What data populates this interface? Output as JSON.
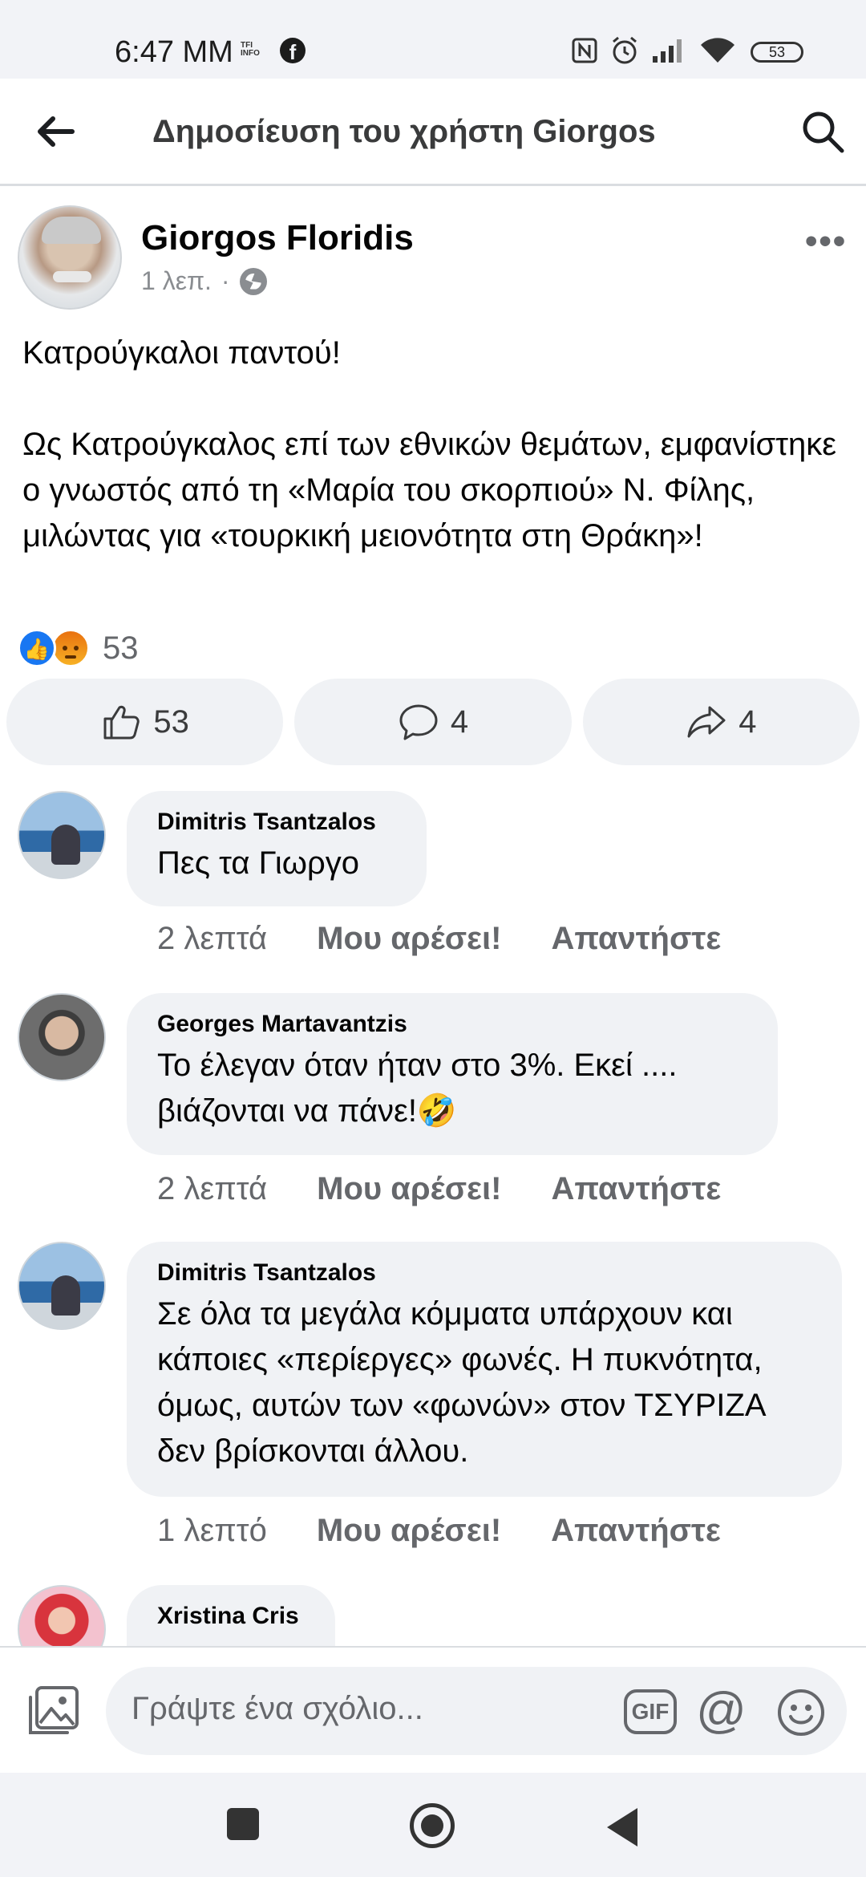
{
  "status_bar": {
    "time": "6:47 MM",
    "tfi_label": "TFI INFO",
    "battery": "53"
  },
  "header": {
    "title": "Δημοσίευση του χρήστη Giorgos"
  },
  "post": {
    "author": "Giorgos Floridis",
    "time": "1 λεπ.",
    "separator": "·",
    "more": "•••",
    "paragraphs": [
      "Κατρούγκαλοι παντού!",
      "Ως Κατρούγκαλος επί των εθνικών θεμάτων, εμφανίστηκε ο γνωστός από τη «Μαρία του σκορπιού» Ν. Φίλης, μιλώντας για «τουρκική μειονότητα στη Θράκη»!"
    ],
    "reaction_count": "53",
    "actions": {
      "like_count": "53",
      "comment_count": "4",
      "share_count": "4"
    }
  },
  "comments": [
    {
      "name": "Dimitris Tsantzalos",
      "text": "Πες τα Γιωργο",
      "time": "2 λεπτά",
      "like_label": "Μου αρέσει!",
      "reply_label": "Απαντήστε"
    },
    {
      "name": "Georges Martavantzis",
      "text": "Το έλεγαν όταν ήταν στο 3%. Εκεί .... βιάζονται να πάνε!🤣",
      "time": "2 λεπτά",
      "like_label": "Μου αρέσει!",
      "reply_label": "Απαντήστε"
    },
    {
      "name": "Dimitris Tsantzalos",
      "text": "Σε όλα τα μεγάλα κόμματα υπάρχουν και κάποιες «περίεργες» φωνές. Η πυκνότητα, όμως, αυτών των «φωνών» στον ΤΣΥΡΙΖΑ δεν βρίσκονται άλλου.",
      "time": "1 λεπτό",
      "like_label": "Μου αρέσει!",
      "reply_label": "Απαντήστε"
    },
    {
      "name": "Xristina Cris"
    }
  ],
  "composer": {
    "placeholder": "Γράψτε ένα σχόλιο...",
    "gif_label": "GIF",
    "at_label": "@"
  },
  "colors": {
    "accent": "#1877f2",
    "bubble_bg": "#f0f2f5",
    "secondary_text": "#65676b"
  }
}
